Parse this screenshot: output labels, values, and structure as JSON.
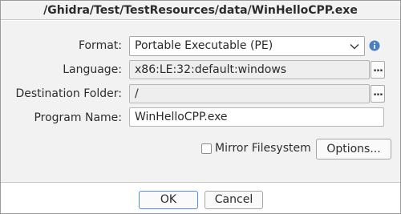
{
  "dialog": {
    "title": "/Ghidra/Test/TestResources/data/WinHelloCPP.exe"
  },
  "form": {
    "format": {
      "label": "Format:",
      "value": "Portable Executable (PE)"
    },
    "language": {
      "label": "Language:",
      "value": "x86:LE:32:default:windows",
      "browse_label": "..."
    },
    "destination": {
      "label": "Destination Folder:",
      "value": "/",
      "browse_label": "..."
    },
    "program_name": {
      "label": "Program Name:",
      "value": "WinHelloCPP.exe"
    }
  },
  "options": {
    "mirror_filesystem_label": "Mirror Filesystem",
    "mirror_filesystem_checked": false,
    "options_button_label": "Options..."
  },
  "buttons": {
    "ok_label": "OK",
    "cancel_label": "Cancel"
  },
  "colors": {
    "info_icon": "#4a7fc1",
    "default_button_border": "#4f8fd6",
    "panel_background": "#f2f2f2"
  },
  "icons": {
    "info": "info-icon",
    "dropdown": "chevron-down-icon"
  }
}
